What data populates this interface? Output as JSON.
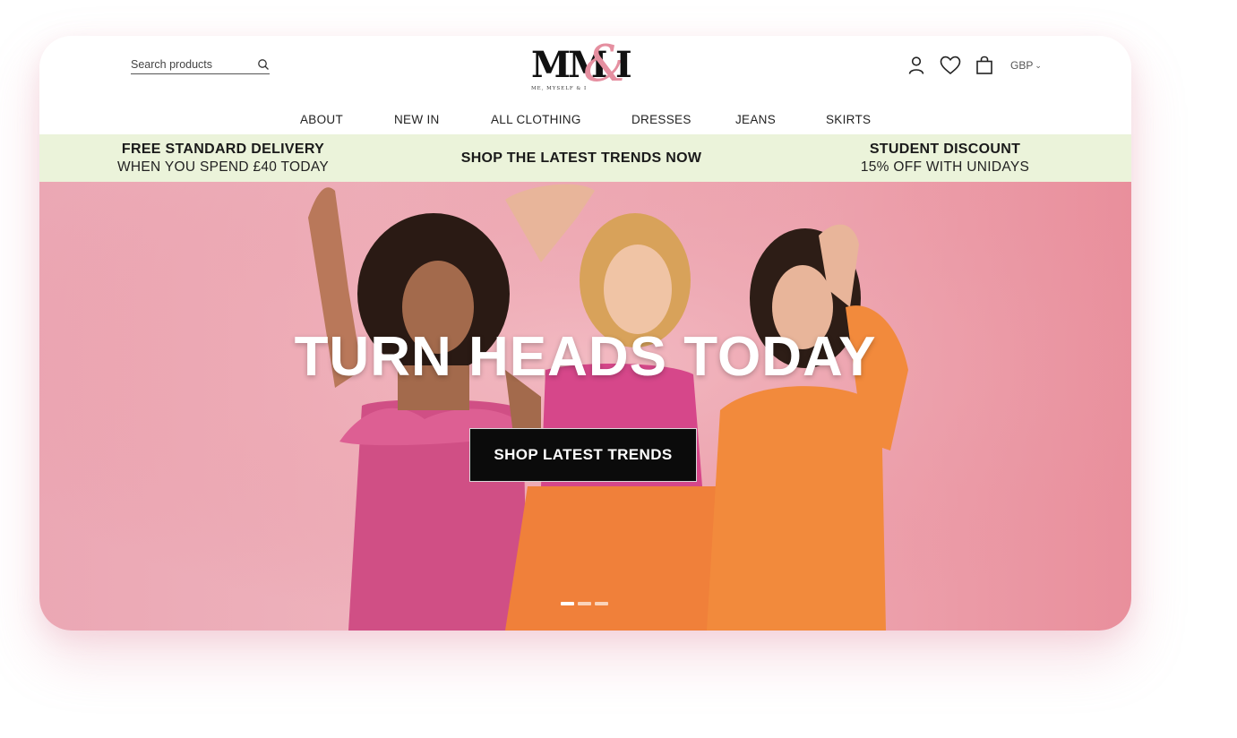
{
  "search": {
    "placeholder": "Search products",
    "value": ""
  },
  "logo": {
    "mark_left": "MM",
    "mark_amp": "&",
    "mark_right": "I",
    "tagline": "ME, MYSELF & I"
  },
  "header_icons": [
    "user-icon",
    "heart-icon",
    "bag-icon"
  ],
  "currency": {
    "value": "GBP"
  },
  "nav": {
    "items": [
      "ABOUT",
      "NEW IN",
      "ALL CLOTHING",
      "DRESSES",
      "JEANS",
      "SKIRTS"
    ]
  },
  "promo": {
    "left": {
      "title": "FREE STANDARD DELIVERY",
      "subtitle": "WHEN YOU SPEND £40 TODAY"
    },
    "center": {
      "title": "SHOP THE LATEST TRENDS NOW"
    },
    "right": {
      "title": "STUDENT DISCOUNT",
      "subtitle": "15% OFF WITH UNIDAYS"
    }
  },
  "hero": {
    "title": "TURN HEADS TODAY",
    "button_label": "SHOP LATEST TRENDS",
    "slides_total": 3,
    "active_slide": 1
  },
  "colors": {
    "promo_bg": "#ebf3da",
    "hero_bg": "#eda5b0",
    "logo_accent": "#e58fa0",
    "button_bg": "#0b0b0b"
  }
}
